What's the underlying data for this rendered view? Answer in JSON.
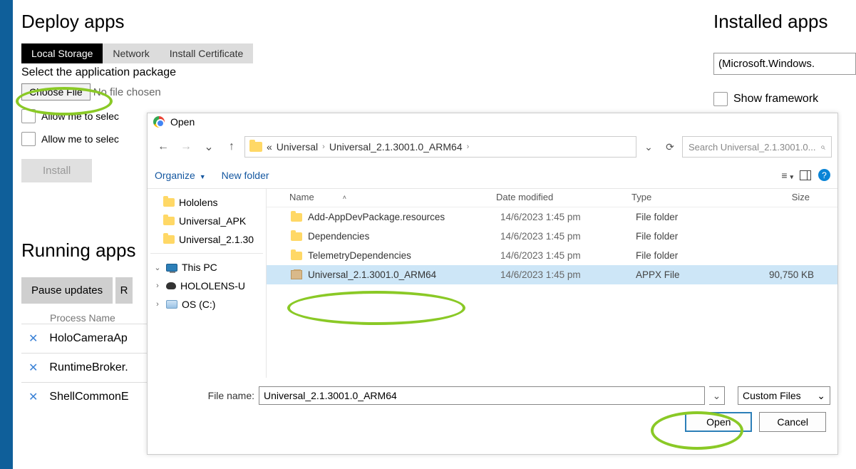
{
  "deploy": {
    "title": "Deploy apps",
    "tabs": {
      "local": "Local Storage",
      "network": "Network",
      "cert": "Install Certificate"
    },
    "select_label": "Select the application package",
    "choose_file": "Choose File",
    "no_file": "No file chosen",
    "allow1": "Allow me to selec",
    "allow2": "Allow me to selec",
    "install": "Install"
  },
  "running": {
    "title": "Running apps",
    "pause": "Pause updates",
    "r": "R",
    "header": "Process Name",
    "rows": [
      "HoloCameraAp",
      "RuntimeBroker.",
      "ShellCommonE"
    ]
  },
  "right": {
    "title": "Installed apps",
    "value": "(Microsoft.Windows.",
    "show_fw": "Show framework"
  },
  "dialog": {
    "title": "Open",
    "crumb_prefix": "«",
    "crumb1": "Universal",
    "crumb2": "Universal_2.1.3001.0_ARM64",
    "search_placeholder": "Search Universal_2.1.3001.0...",
    "organize": "Organize",
    "new_folder": "New folder",
    "sidebar": {
      "hololens": "Hololens",
      "u_apk": "Universal_APK",
      "u_21": "Universal_2.1.30",
      "this_pc": "This PC",
      "holo_u": "HOLOLENS-U",
      "os_c": "OS (C:)"
    },
    "cols": {
      "name": "Name",
      "date": "Date modified",
      "type": "Type",
      "size": "Size"
    },
    "rows": [
      {
        "name": "Add-AppDevPackage.resources",
        "date": "14/6/2023 1:45 pm",
        "type": "File folder",
        "size": "",
        "kind": "folder"
      },
      {
        "name": "Dependencies",
        "date": "14/6/2023 1:45 pm",
        "type": "File folder",
        "size": "",
        "kind": "folder"
      },
      {
        "name": "TelemetryDependencies",
        "date": "14/6/2023 1:45 pm",
        "type": "File folder",
        "size": "",
        "kind": "folder"
      },
      {
        "name": "Universal_2.1.3001.0_ARM64",
        "date": "14/6/2023 1:45 pm",
        "type": "APPX File",
        "size": "90,750 KB",
        "kind": "appx"
      }
    ],
    "file_name_label": "File name:",
    "file_name_value": "Universal_2.1.3001.0_ARM64",
    "filter": "Custom Files",
    "open": "Open",
    "cancel": "Cancel"
  }
}
